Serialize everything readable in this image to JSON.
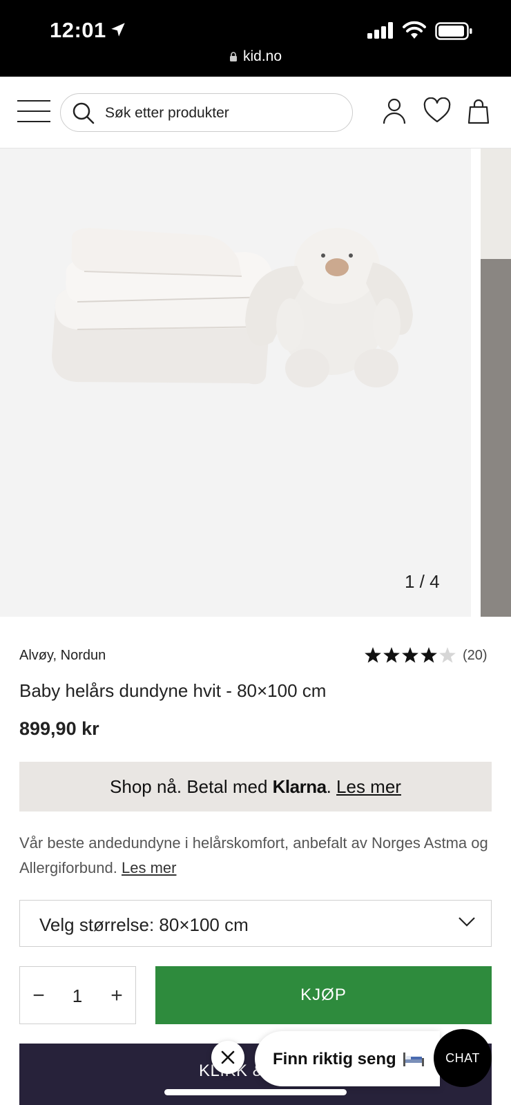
{
  "status_bar": {
    "time": "12:01",
    "url": "kid.no"
  },
  "header": {
    "search_placeholder": "Søk etter produkter",
    "icons": [
      "menu-icon",
      "search-icon",
      "account-icon",
      "heart-icon",
      "bag-icon"
    ]
  },
  "gallery": {
    "counter": "1 / 4",
    "current": 1,
    "total": 4
  },
  "product": {
    "brand": "Alvøy, Nordun",
    "rating": 4,
    "rating_max": 5,
    "rating_count": "(20)",
    "title": "Baby helårs dundyne hvit - 80×100 cm",
    "price": "899,90 kr"
  },
  "klarna": {
    "prefix": "Shop nå. Betal med ",
    "brand": "Klarna",
    "dot": ".",
    "link": "Les mer"
  },
  "description": {
    "text": "Vår beste andedundyne i helårskomfort, anbefalt av Norges Astma og Allergiforbund.",
    "link": "Les mer"
  },
  "size_select": {
    "label": "Velg størrelse: 80×100 cm"
  },
  "quantity": {
    "minus": "−",
    "value": "1",
    "plus": "+"
  },
  "buy_button": "KJØP",
  "dark_button": "KLIKK &",
  "finn_bubble": "Finn riktig seng",
  "chat_button": "CHAT",
  "colors": {
    "buy_green": "#2e8b3d",
    "klarna_bg": "#e9e6e3",
    "dark_button": "#27223a"
  }
}
